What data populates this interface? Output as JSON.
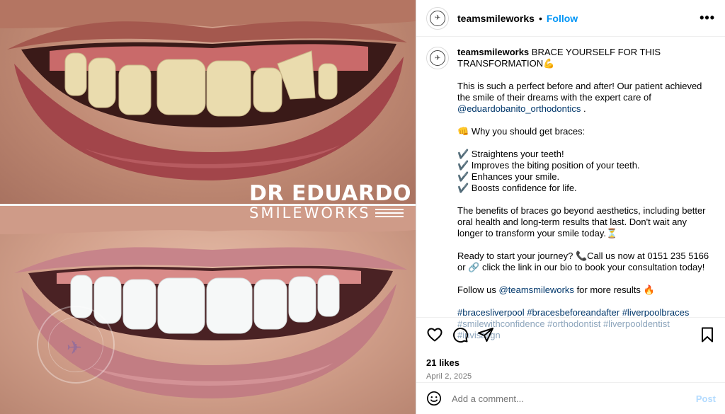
{
  "image": {
    "brand_line1": "DR EDUARDO",
    "brand_line2": "SMILEWORKS"
  },
  "header": {
    "username": "teamsmileworks",
    "dot": "•",
    "follow_label": "Follow",
    "more_label": "•••"
  },
  "caption": {
    "username": "teamsmileworks",
    "headline": "BRACE YOURSELF FOR THIS TRANSFORMATION",
    "headline_emoji": "💪",
    "p1_text": "This is such a perfect before and after! Our patient achieved the smile of their dreams with the expert care of",
    "p1_mention": "@eduardobanito_orthodontics",
    "p1_end": ".",
    "why_emoji": "👊",
    "why_text": "Why you should get braces:",
    "benefits": [
      "✔️ Straightens your teeth!",
      "✔️ Improves the biting position of your teeth.",
      "✔️ Enhances your smile.",
      "✔️ Boosts confidence for life."
    ],
    "p3_text": "The benefits of braces go beyond aesthetics, including better oral health and long-term results that last. Don't wait any longer to transform your smile today.",
    "p3_emoji": "⏳",
    "p4_a": "Ready to start your journey?",
    "p4_phone_emoji": "📞",
    "p4_b": "Call us now at 0151 235 5166 or",
    "p4_link_emoji": "🔗",
    "p4_c": "click the link in our bio to book your consultation today!",
    "p5_a": "Follow us",
    "p5_mention": "@teamsmileworks",
    "p5_b": "for more results",
    "p5_emoji": "🔥",
    "hashtags": "#bracesliverpool #bracesbeforeandafter #liverpoolbraces",
    "hashtags_partial": "#smilewithconfidence #orthodontist #liverpooldentist #invisalign"
  },
  "actions": {
    "likes": "21 likes",
    "date": "April 2, 2025"
  },
  "comment": {
    "placeholder": "Add a comment...",
    "post_label": "Post"
  },
  "colors": {
    "accent": "#0095f6",
    "link": "#00376b",
    "muted": "#737373",
    "post_disabled": "#b3dbff"
  },
  "icons": [
    "heart-icon",
    "comment-icon",
    "share-icon",
    "bookmark-icon",
    "emoji-icon",
    "more-icon"
  ]
}
